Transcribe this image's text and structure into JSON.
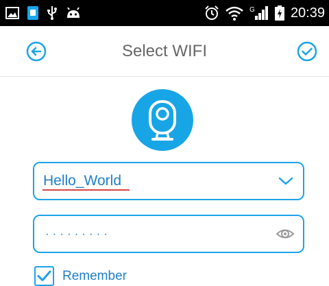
{
  "status_bar": {
    "time": "20:39",
    "network_type": "G",
    "icons": [
      "gallery-icon",
      "app-notification-icon",
      "usb-icon",
      "android-debug-icon",
      "alarm-icon",
      "wifi-icon",
      "signal-icon",
      "battery-charging-icon"
    ]
  },
  "header": {
    "title": "Select WIFI",
    "back_icon": "back-arrow-circle-icon",
    "confirm_icon": "check-circle-icon"
  },
  "logo": {
    "icon": "camera-icon",
    "color": "#17a5e6"
  },
  "form": {
    "ssid_value": "Hello_World",
    "password_mask": "·········",
    "remember_label": "Remember",
    "remember_checked": true
  },
  "colors": {
    "accent": "#1ba3e8",
    "text_blue": "#1f7fc9",
    "title_gray": "#666666"
  }
}
